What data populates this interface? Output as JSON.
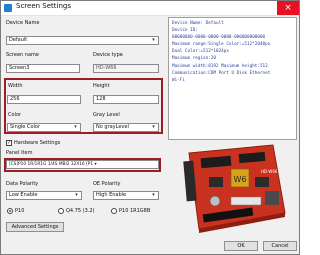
{
  "window": {
    "title": "Screen Settings",
    "close": "×"
  },
  "device": {
    "label": "Device Name",
    "value": "Default"
  },
  "screen": {
    "name_label": "Screen name",
    "name_value": "Screen3",
    "type_label": "Device type",
    "type_value": "HD-W66"
  },
  "size": {
    "width_label": "Width",
    "width_value": "256",
    "height_label": "Height",
    "height_value": "128"
  },
  "color": {
    "color_label": "Color",
    "color_value": "Single Color",
    "gray_label": "Gray Level",
    "gray_value": "No grayLevel"
  },
  "hardware": {
    "label": "Hardware Settings",
    "checked": "✓"
  },
  "panel": {
    "label": "Panel Item",
    "value": "[CS]P10          1R/1R1G          1/4S   MBI2 32X16 [P1 ▾"
  },
  "polarity": {
    "data_label": "Data Polarity",
    "data_value": "Low Enable",
    "oe_label": "OE Polarity",
    "oe_value": "High Enable"
  },
  "radios": [
    {
      "label": "P10",
      "checked": true
    },
    {
      "label": "Q4.75 (3.2)",
      "checked": false
    },
    {
      "label": "P10 1R1G8B",
      "checked": false
    }
  ],
  "advanced": "Advanced Settings",
  "info_lines": [
    "Device Name: Default",
    "Device ID:",
    "00000000-0000-0000-0000-000000000000",
    "Maximum range:Single Color:=512*2048px",
    "Dual Color:=512*1024px",
    "Maximum region:20",
    "Maximum width:8192 Maximum height:512",
    "Communication:COM Port  U Disk  Ethernet",
    "Wi-Fi"
  ],
  "buttons": {
    "ok": "OK",
    "cancel": "Cancel"
  },
  "board": {
    "chip_text": "W6",
    "brand": "HD-W66"
  },
  "colors": {
    "accent_red": "#9e1c25",
    "info_text": "#2f3f9a",
    "board": "#c8321e"
  }
}
